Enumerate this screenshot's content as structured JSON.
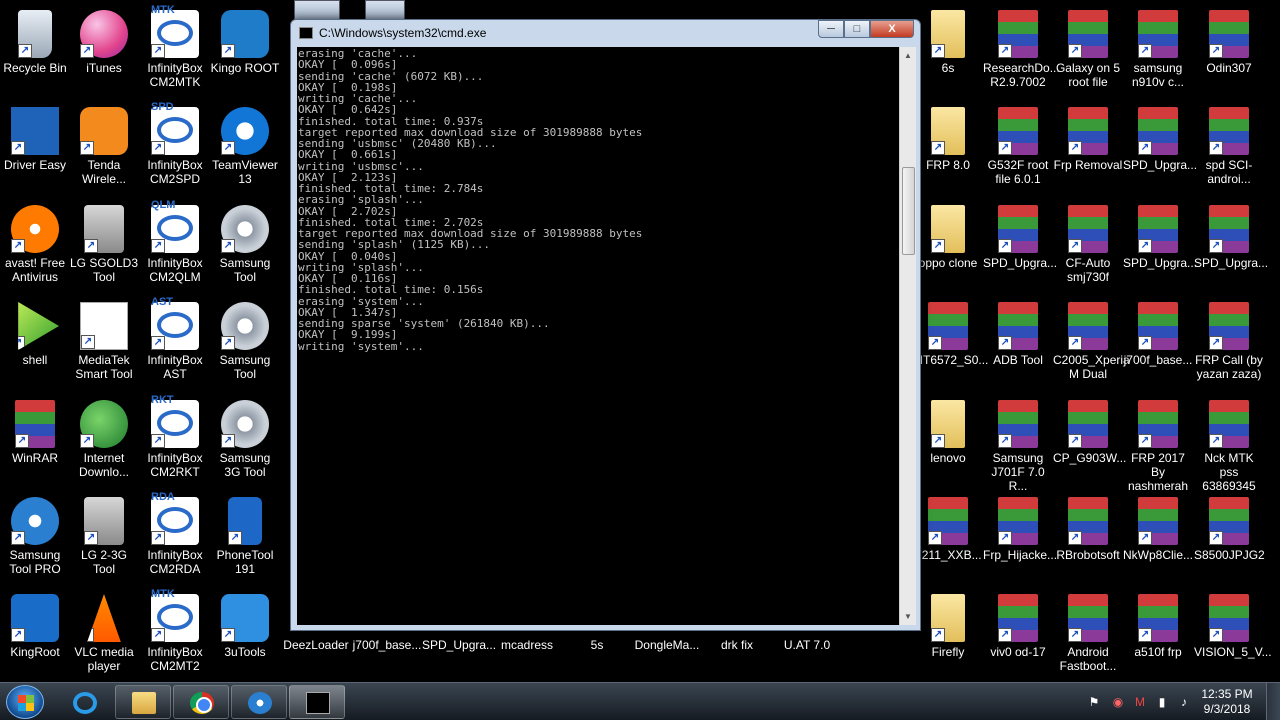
{
  "desktop_icons": {
    "col1": [
      "Recycle Bin",
      "Driver Easy",
      "avast! Free Antivirus",
      "shell",
      "WinRAR",
      "Samsung Tool PRO",
      "KingRoot"
    ],
    "col2": [
      "iTunes",
      "Tenda Wirele...",
      "LG SGOLD3 Tool",
      "MediaTek Smart Tool",
      "Internet Downlo...",
      "LG 2-3G Tool",
      "VLC media player"
    ],
    "col3": [
      "InfinityBox CM2MTK",
      "InfinityBox CM2SPD",
      "InfinityBox CM2QLM",
      "InfinityBox AST",
      "InfinityBox CM2RKT",
      "InfinityBox CM2RDA",
      "InfinityBox CM2MT2"
    ],
    "col3_tags": [
      "MTK",
      "SPD",
      "QLM",
      "AST",
      "RKT",
      "RDA",
      "MTK"
    ],
    "col4": [
      "Kingo ROOT",
      "TeamViewer 13",
      "Samsung Tool",
      "Samsung Tool",
      "Samsung 3G Tool",
      "PhoneTool 191",
      "3uTools"
    ],
    "bottom_row": [
      "DeezLoader",
      "j700f_base...",
      "SPD_Upgra...",
      "mcadress",
      "5s",
      "DongleMa...",
      "drk fix",
      "U.AT 7.0"
    ],
    "col_r1": [
      "6s",
      "FRP 8.0",
      "oppo clone",
      "MT6572_S0...",
      "lenovo",
      "F211_XXB...",
      "Firefly"
    ],
    "col_r2": [
      "ResearchDo... R2.9.7002",
      "G532F root file 6.0.1",
      "SPD_Upgra...",
      "ADB Tool",
      "Samsung J701F 7.0 R...",
      "Frp_Hijacke...",
      "viv0 od-17"
    ],
    "col_r3": [
      "Galaxy on 5 root file",
      "Frp Removal",
      "CF-Auto smj730f",
      "C2005_Xperia M Dual",
      "CP_G903W...",
      "RBrobotsoft",
      "Android Fastboot..."
    ],
    "col_r4": [
      "samsung n910v c...",
      "SPD_Upgra...",
      "SPD_Upgra...",
      "j700f_base...",
      "FRP 2017 By nashmerah",
      "NkWp8Clie...",
      "a510f frp"
    ],
    "col_r5": [
      "Odin307",
      "spd SCI-androi...",
      "SPD_Upgra...",
      "FRP Call (by yazan zaza)",
      "Nck MTK pss 63869345",
      "S8500JPJG2",
      "VISION_5_V..."
    ]
  },
  "cmd_window": {
    "title": "C:\\Windows\\system32\\cmd.exe",
    "icon": "console-icon",
    "controls": {
      "minimize": "─",
      "maximize": "□",
      "close": "X"
    },
    "console_text": "erasing 'cache'...\nOKAY [  0.096s]\nsending 'cache' (6072 KB)...\nOKAY [  0.198s]\nwriting 'cache'...\nOKAY [  0.642s]\nfinished. total time: 0.937s\ntarget reported max download size of 301989888 bytes\nsending 'usbmsc' (20480 KB)...\nOKAY [  0.661s]\nwriting 'usbmsc'...\nOKAY [  2.123s]\nfinished. total time: 2.784s\nerasing 'splash'...\nOKAY [  2.702s]\nfinished. total time: 2.702s\ntarget reported max download size of 301989888 bytes\nsending 'splash' (1125 KB)...\nOKAY [  0.040s]\nwriting 'splash'...\nOKAY [  0.116s]\nfinished. total time: 0.156s\nerasing 'system'...\nOKAY [  1.347s]\nsending sparse 'system' (261840 KB)...\nOKAY [  9.199s]\nwriting 'system'...",
    "scrollbar": {
      "up": "▲",
      "down": "▼"
    }
  },
  "taskbar": {
    "pinned": [
      "internet-explorer-icon",
      "windows-explorer-icon",
      "chrome-icon",
      "samsung-tool-icon",
      "cmd-icon"
    ],
    "tray_icons": [
      "flag-icon",
      "opera-icon",
      "gmail-icon",
      "signal-icon",
      "volume-icon"
    ],
    "time": "12:35 PM",
    "date": "9/3/2018"
  },
  "colors": {
    "desktop_bg": "#000000",
    "console_text": "#c0c0c0",
    "close_button": "#c23a22"
  }
}
